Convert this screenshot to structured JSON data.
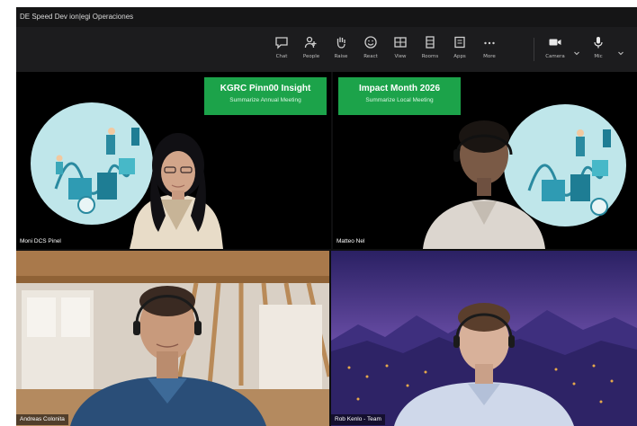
{
  "window": {
    "title": "DE Speed Dev ion|egi Operaciones"
  },
  "toolbar": {
    "items": [
      {
        "label": "Chat",
        "icon": "chat-icon"
      },
      {
        "label": "People",
        "icon": "people-icon"
      },
      {
        "label": "Raise",
        "icon": "raise-hand-icon"
      },
      {
        "label": "React",
        "icon": "react-icon"
      },
      {
        "label": "View",
        "icon": "view-icon"
      },
      {
        "label": "Rooms",
        "icon": "rooms-icon"
      },
      {
        "label": "Apps",
        "icon": "apps-icon"
      },
      {
        "label": "More",
        "icon": "more-icon"
      },
      {
        "label": "Camera",
        "icon": "camera-icon"
      },
      {
        "label": "Mic",
        "icon": "mic-icon"
      }
    ]
  },
  "participants": [
    {
      "name": "Moni DCS Pinel",
      "banner_title": "KGRC Pinn00 Insight",
      "banner_subtitle": "Summarize Annual Meeting"
    },
    {
      "name": "Matteo Nel",
      "banner_title": "Impact Month 2026",
      "banner_subtitle": "Summarize Local Meeting"
    },
    {
      "name": "Andreas Colonita"
    },
    {
      "name": "Rob Kenlo - Team"
    }
  ],
  "colors": {
    "banner": "#1ca34a",
    "background": "#0f0f10",
    "toolbar": "#1c1c1e",
    "tile_border": "#7b74c9"
  }
}
